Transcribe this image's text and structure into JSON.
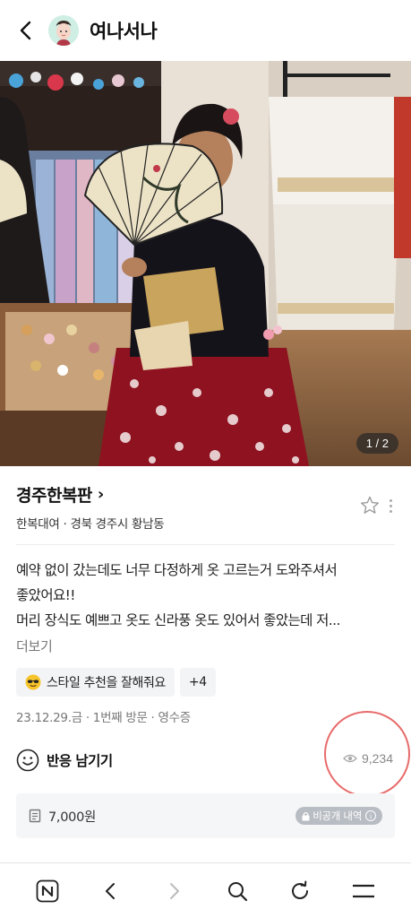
{
  "header": {
    "profile_name": "여나서나",
    "back_icon": "chevron-left-icon"
  },
  "photo": {
    "counter": "1 / 2"
  },
  "place": {
    "name": "경주한복판",
    "chevron": "›",
    "meta": "한복대여 · 경북 경주시 황남동"
  },
  "review": {
    "lines": [
      "예약 없이 갔는데도 너무 다정하게 옷 고르는거 도와주셔서",
      "좋았어요!!",
      "머리 장식도 예쁘고 옷도 신라풍 옷도 있어서 좋았는데 저..."
    ],
    "more_label": "더보기"
  },
  "chips": [
    {
      "label": "스타일 추천을 잘해줘요",
      "icon": "sunglasses-emoji-icon"
    },
    {
      "label": "+4"
    }
  ],
  "visit_meta": "23.12.29.금 · 1번째 방문 · 영수증",
  "reaction": {
    "label": "반응 남기기",
    "views": "9,234"
  },
  "price_box": {
    "price": "7,000원",
    "badge": "비공개 내역"
  },
  "colors": {
    "highlight_circle": "#e86b6b",
    "badge_bg": "#b8bcc3",
    "box_bg": "#f5f6f8"
  }
}
